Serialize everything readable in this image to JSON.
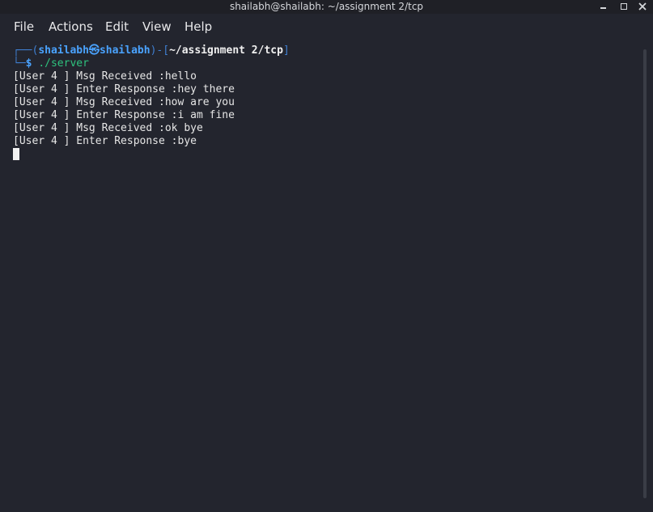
{
  "window": {
    "title": "shailabh@shailabh: ~/assignment 2/tcp"
  },
  "menu": {
    "items": [
      "File",
      "Actions",
      "Edit",
      "View",
      "Help"
    ]
  },
  "prompt": {
    "box_top_left": "┌──(",
    "user": "shailabh",
    "skull": "㉿",
    "host": "shailabh",
    "mid": ")-[",
    "path": "~/assignment 2/tcp",
    "end": "]",
    "box_bottom_left": "└─",
    "dollar": "$",
    "command": "./server"
  },
  "output": {
    "lines": [
      "[User 4 ] Msg Received :hello",
      "[User 4 ] Enter Response :hey there",
      "[User 4 ] Msg Received :how are you",
      "[User 4 ] Enter Response :i am fine",
      "[User 4 ] Msg Received :ok bye",
      "[User 4 ] Enter Response :bye"
    ]
  },
  "icons": {
    "minimize": "minimize-icon",
    "maximize": "maximize-icon",
    "close": "close-icon",
    "cursor": "terminal-cursor"
  }
}
